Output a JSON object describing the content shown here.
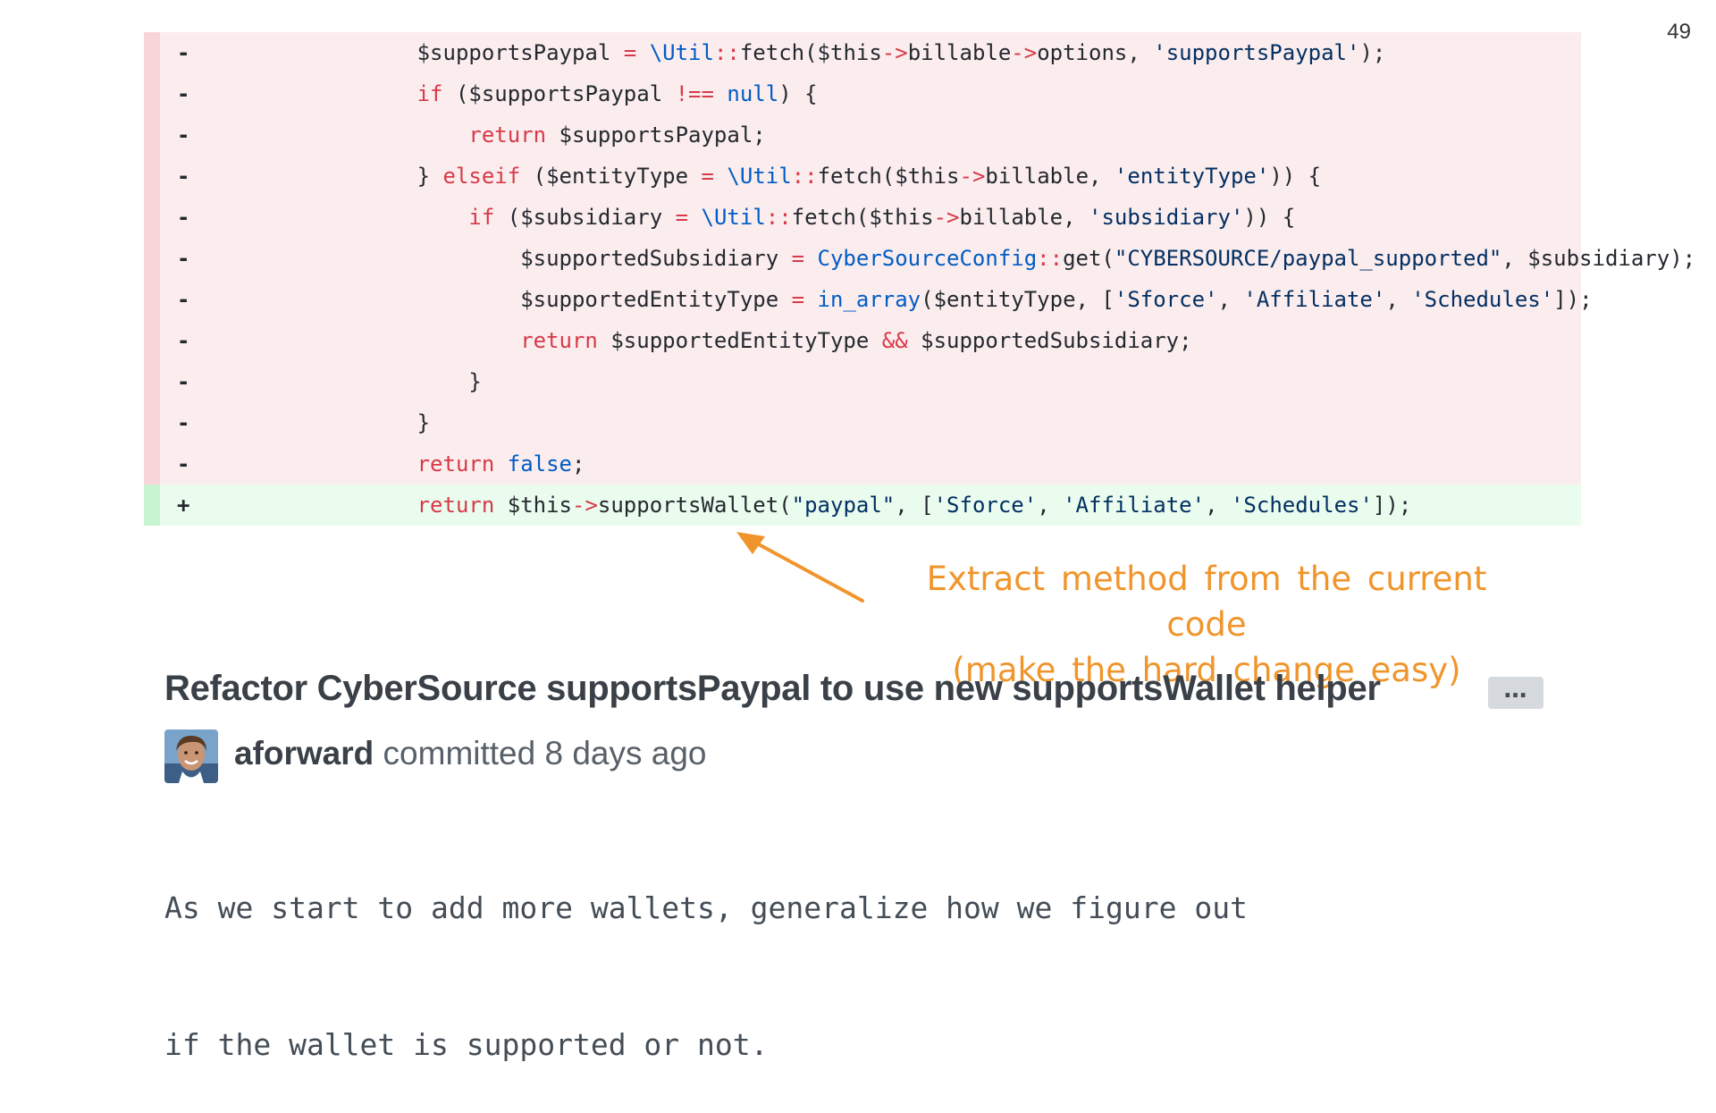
{
  "slide_number": "49",
  "diff_lines": [
    {
      "type": "del",
      "marker": "-",
      "tokens": [
        [
          "plain",
          "        $supportsPaypal "
        ],
        [
          "op",
          "="
        ],
        [
          "plain",
          " "
        ],
        [
          "cls",
          "\\Util"
        ],
        [
          "op",
          "::"
        ],
        [
          "plain",
          "fetch($this"
        ],
        [
          "op",
          "->"
        ],
        [
          "plain",
          "billable"
        ],
        [
          "op",
          "->"
        ],
        [
          "plain",
          "options, "
        ],
        [
          "str",
          "'supportsPaypal'"
        ],
        [
          "plain",
          ");"
        ]
      ]
    },
    {
      "type": "del",
      "marker": "-",
      "tokens": [
        [
          "plain",
          "        "
        ],
        [
          "kw",
          "if"
        ],
        [
          "plain",
          " ($supportsPaypal "
        ],
        [
          "op",
          "!=="
        ],
        [
          "plain",
          " "
        ],
        [
          "cls",
          "null"
        ],
        [
          "plain",
          ") {"
        ]
      ]
    },
    {
      "type": "del",
      "marker": "-",
      "tokens": [
        [
          "plain",
          "            "
        ],
        [
          "kw",
          "return"
        ],
        [
          "plain",
          " $supportsPaypal;"
        ]
      ]
    },
    {
      "type": "del",
      "marker": "-",
      "tokens": [
        [
          "plain",
          "        } "
        ],
        [
          "kw",
          "elseif"
        ],
        [
          "plain",
          " ($entityType "
        ],
        [
          "op",
          "="
        ],
        [
          "plain",
          " "
        ],
        [
          "cls",
          "\\Util"
        ],
        [
          "op",
          "::"
        ],
        [
          "plain",
          "fetch($this"
        ],
        [
          "op",
          "->"
        ],
        [
          "plain",
          "billable, "
        ],
        [
          "str",
          "'entityType'"
        ],
        [
          "plain",
          ")) {"
        ]
      ]
    },
    {
      "type": "del",
      "marker": "-",
      "tokens": [
        [
          "plain",
          "            "
        ],
        [
          "kw",
          "if"
        ],
        [
          "plain",
          " ($subsidiary "
        ],
        [
          "op",
          "="
        ],
        [
          "plain",
          " "
        ],
        [
          "cls",
          "\\Util"
        ],
        [
          "op",
          "::"
        ],
        [
          "plain",
          "fetch($this"
        ],
        [
          "op",
          "->"
        ],
        [
          "plain",
          "billable, "
        ],
        [
          "str",
          "'subsidiary'"
        ],
        [
          "plain",
          ")) {"
        ]
      ]
    },
    {
      "type": "del",
      "marker": "-",
      "tokens": [
        [
          "plain",
          "                $supportedSubsidiary "
        ],
        [
          "op",
          "="
        ],
        [
          "plain",
          " "
        ],
        [
          "cls",
          "CyberSourceConfig"
        ],
        [
          "op",
          "::"
        ],
        [
          "plain",
          "get("
        ],
        [
          "str",
          "\"CYBERSOURCE/paypal_supported\""
        ],
        [
          "plain",
          ", $subsidiary);"
        ]
      ]
    },
    {
      "type": "del",
      "marker": "-",
      "tokens": [
        [
          "plain",
          "                $supportedEntityType "
        ],
        [
          "op",
          "="
        ],
        [
          "plain",
          " "
        ],
        [
          "cls",
          "in_array"
        ],
        [
          "plain",
          "($entityType, ["
        ],
        [
          "str",
          "'Sforce'"
        ],
        [
          "plain",
          ", "
        ],
        [
          "str",
          "'Affiliate'"
        ],
        [
          "plain",
          ", "
        ],
        [
          "str",
          "'Schedules'"
        ],
        [
          "plain",
          "]);"
        ]
      ]
    },
    {
      "type": "del",
      "marker": "-",
      "tokens": [
        [
          "plain",
          "                "
        ],
        [
          "kw",
          "return"
        ],
        [
          "plain",
          " $supportedEntityType "
        ],
        [
          "op",
          "&&"
        ],
        [
          "plain",
          " $supportedSubsidiary;"
        ]
      ]
    },
    {
      "type": "del",
      "marker": "-",
      "tokens": [
        [
          "plain",
          "            }"
        ]
      ]
    },
    {
      "type": "del",
      "marker": "-",
      "tokens": [
        [
          "plain",
          "        }"
        ]
      ]
    },
    {
      "type": "del",
      "marker": "-",
      "tokens": [
        [
          "plain",
          "        "
        ],
        [
          "kw",
          "return"
        ],
        [
          "plain",
          " "
        ],
        [
          "cls",
          "false"
        ],
        [
          "plain",
          ";"
        ]
      ]
    },
    {
      "type": "add",
      "marker": "+",
      "tokens": [
        [
          "plain",
          "        "
        ],
        [
          "kw",
          "return"
        ],
        [
          "plain",
          " $this"
        ],
        [
          "op",
          "->"
        ],
        [
          "plain",
          "supportsWallet("
        ],
        [
          "str",
          "\"paypal\""
        ],
        [
          "plain",
          ", ["
        ],
        [
          "str",
          "'Sforce'"
        ],
        [
          "plain",
          ", "
        ],
        [
          "str",
          "'Affiliate'"
        ],
        [
          "plain",
          ", "
        ],
        [
          "str",
          "'Schedules'"
        ],
        [
          "plain",
          "]);"
        ]
      ]
    }
  ],
  "annotation": {
    "line1": "Extract method from the current code",
    "line2": "(make the hard change easy)",
    "color": "#f0952c"
  },
  "commit": {
    "title": "Refactor CyberSource supportsPaypal to use new supportsWallet helper",
    "more_label": "…",
    "author": "aforward",
    "meta": "committed 8 days ago",
    "body_line1": "As we start to add more wallets, generalize how we figure out",
    "body_line2": "if the wallet is supported or not."
  },
  "colors": {
    "deleted_bg": "#fbedee",
    "added_bg": "#eafcee",
    "keyword": "#d73a49",
    "class": "#005cc5",
    "string": "#032f62"
  }
}
